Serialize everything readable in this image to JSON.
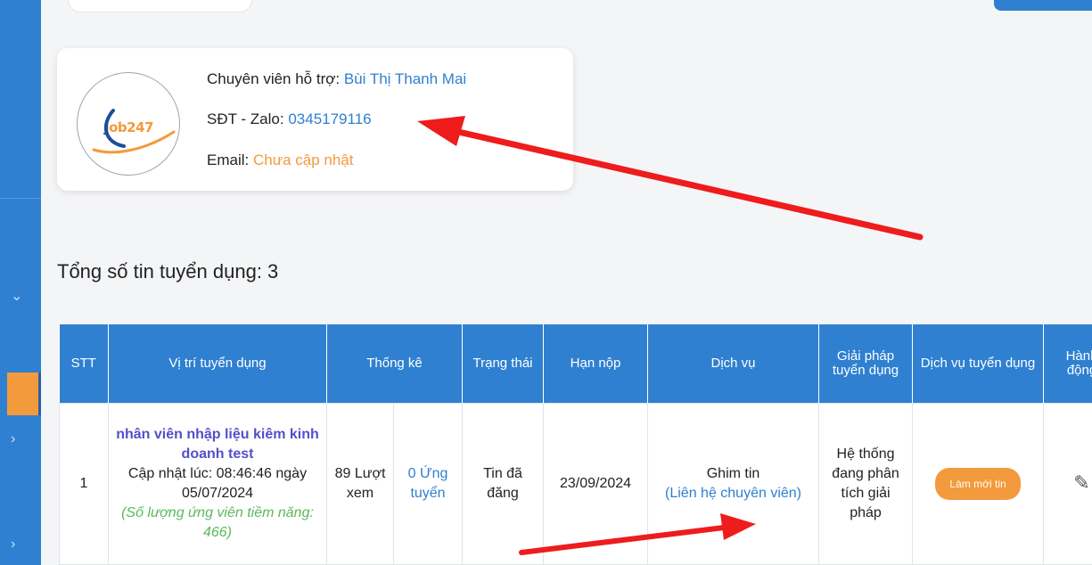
{
  "support": {
    "specialist_label": "Chuyên viên hỗ trợ: ",
    "specialist_name": "Bùi Thị Thanh Mai",
    "phone_label": "SĐT - Zalo: ",
    "phone_value": "0345179116",
    "email_label": "Email: ",
    "email_value": "Chưa cập nhật",
    "logo_text_j": "J",
    "logo_text_rest": "ob247"
  },
  "jobs": {
    "total_label": "Tổng số tin tuyển dụng: 3",
    "columns": [
      "STT",
      "Vị trí tuyển dụng",
      "Thống kê",
      "Trạng thái",
      "Hạn nộp",
      "Dịch vụ",
      "Giải pháp tuyển dụng",
      "Dịch vụ tuyển dụng",
      "Hành động"
    ],
    "rows": [
      {
        "stt": "1",
        "title": "nhân viên nhập liệu kiêm kinh doanh test",
        "updated": "Cập nhật lúc: 08:46:46 ngày 05/07/2024",
        "candidates": "(Số lượng ứng viên tiềm năng: 466)",
        "views": "89 Lượt xem",
        "applies": "0 Ứng tuyển",
        "status": "Tin đã đăng",
        "deadline": "23/09/2024",
        "service": "Ghim tin",
        "service_contact": "(Liên hệ chuyên viên)",
        "solution": "Hệ thống đang phân tích giải pháp",
        "renew_label": "Làm mới tin"
      }
    ]
  },
  "colors": {
    "primary": "#2f80d1",
    "accent": "#f39a3c",
    "link": "#2f7fd0",
    "title": "#5350c8",
    "green": "#5cb85c",
    "annotation_arrow": "#ee1c1c"
  },
  "icons": [
    "chevron-down-icon",
    "chevron-right-icon",
    "pencil-icon"
  ]
}
